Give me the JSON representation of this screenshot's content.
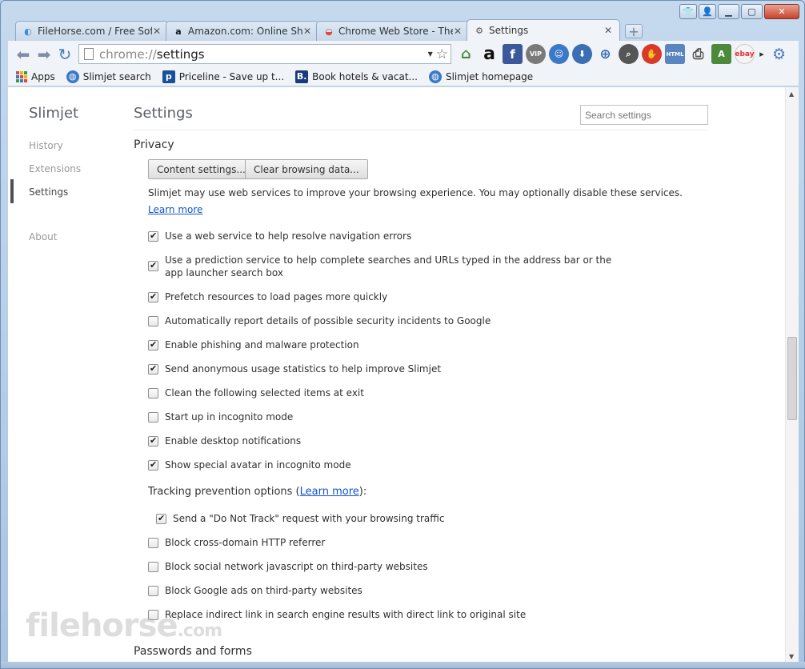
{
  "window": {
    "controls": [
      "minimize",
      "maximize",
      "close"
    ]
  },
  "tabs": [
    {
      "title": "FileHorse.com / Free Softw",
      "icon": "filehorse-icon",
      "active": false
    },
    {
      "title": "Amazon.com: Online Shop",
      "icon": "amazon-icon",
      "active": false
    },
    {
      "title": "Chrome Web Store - Then",
      "icon": "webstore-icon",
      "active": false
    },
    {
      "title": "Settings",
      "icon": "gear-icon",
      "active": true
    }
  ],
  "toolbar": {
    "url_scheme": "chrome://",
    "url_path": "settings"
  },
  "bookmarks": [
    {
      "label": "Apps",
      "icon": "apps-grid-icon"
    },
    {
      "label": "Slimjet search",
      "icon": "globe-icon"
    },
    {
      "label": "Priceline - Save up t...",
      "icon": "priceline-icon"
    },
    {
      "label": "Book hotels & vacat...",
      "icon": "booking-icon"
    },
    {
      "label": "Slimjet homepage",
      "icon": "globe-icon"
    }
  ],
  "nav": {
    "brand": "Slimjet",
    "items": [
      {
        "label": "History",
        "active": false
      },
      {
        "label": "Extensions",
        "active": false
      },
      {
        "label": "Settings",
        "active": true
      },
      {
        "label": "About",
        "active": false
      }
    ]
  },
  "settings": {
    "title": "Settings",
    "search_placeholder": "Search settings",
    "privacy": {
      "title": "Privacy",
      "content_settings_btn": "Content settings...",
      "clear_data_btn": "Clear browsing data...",
      "description": "Slimjet may use web services to improve your browsing experience. You may optionally disable these services.",
      "learn_more": "Learn more",
      "options": [
        {
          "label": "Use a web service to help resolve navigation errors",
          "checked": true
        },
        {
          "label": "Use a prediction service to help complete searches and URLs typed in the address bar or the app launcher search box",
          "checked": true
        },
        {
          "label": "Prefetch resources to load pages more quickly",
          "checked": true
        },
        {
          "label": "Automatically report details of possible security incidents to Google",
          "checked": false
        },
        {
          "label": "Enable phishing and malware protection",
          "checked": true
        },
        {
          "label": "Send anonymous usage statistics to help improve Slimjet",
          "checked": true
        },
        {
          "label": "Clean the following selected items at exit",
          "checked": false
        },
        {
          "label": "Start up in incognito mode",
          "checked": false
        },
        {
          "label": "Enable desktop notifications",
          "checked": true
        },
        {
          "label": "Show special avatar in incognito mode",
          "checked": true
        }
      ],
      "tracking_prefix": "Tracking prevention options (",
      "tracking_link": "Learn more",
      "tracking_suffix": "):",
      "tracking_options": [
        {
          "label": "Send a \"Do Not Track\" request with your browsing traffic",
          "checked": true
        },
        {
          "label": "Block cross-domain HTTP referrer",
          "checked": false
        },
        {
          "label": "Block social network javascript on third-party websites",
          "checked": false
        },
        {
          "label": "Block Google ads on third-party websites",
          "checked": false
        },
        {
          "label": "Replace indirect link in search engine results with direct link to original site",
          "checked": false
        }
      ]
    },
    "passwords_title": "Passwords and forms"
  },
  "watermark": {
    "text": "filehorse",
    "suffix": ".com"
  }
}
